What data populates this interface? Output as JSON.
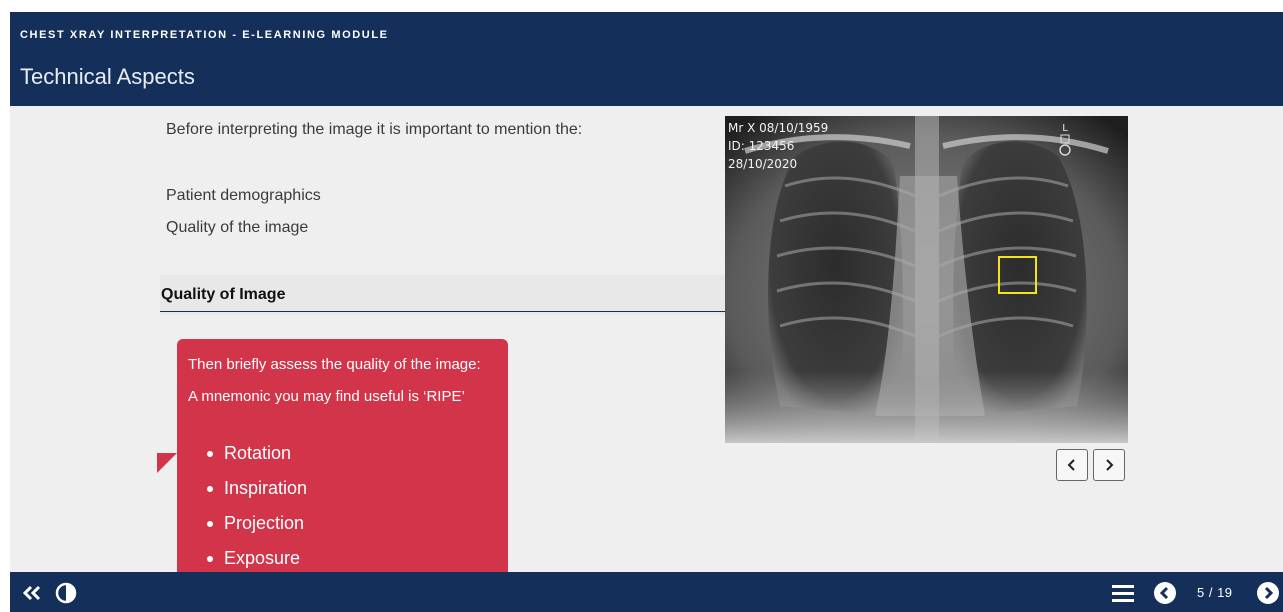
{
  "header": {
    "module_title": "CHEST XRAY INTERPRETATION - E-LEARNING MODULE",
    "page_title": "Technical Aspects"
  },
  "content": {
    "intro": "Before interpreting the image it is important to mention the:",
    "mention_items": [
      "Patient demographics",
      "Quality of the image"
    ],
    "section_heading": "Quality of Image"
  },
  "callout": {
    "line1": "Then briefly assess the quality of the image:",
    "line2": "A mnemonic you may find useful is ‘RIPE’",
    "items": [
      "Rotation",
      "Inspiration",
      "Projection",
      "Exposure"
    ],
    "color": "#d2344a"
  },
  "xray": {
    "patient": "Mr X  08/10/1959",
    "id": "ID: 123456",
    "date": "28/10/2020",
    "side_marker": "L"
  },
  "image_nav": {
    "prev_icon": "chevron-left-icon",
    "next_icon": "chevron-right-icon"
  },
  "footer": {
    "back_icon": "double-chevron-left-icon",
    "contrast_icon": "contrast-icon",
    "menu_icon": "hamburger-menu-icon",
    "prev_icon": "circle-chevron-left-icon",
    "next_icon": "circle-chevron-right-icon",
    "page_counter": "5 / 19"
  },
  "colors": {
    "brand_navy": "#14305a",
    "accent_red": "#d2344a",
    "roi_yellow": "#f2e31b"
  }
}
